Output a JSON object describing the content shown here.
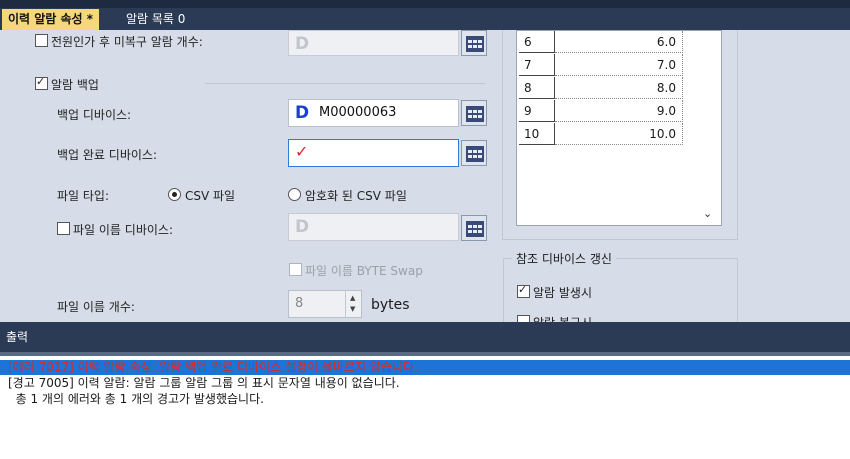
{
  "tabs": [
    {
      "label": "이력 알람 속성 *",
      "active": true
    },
    {
      "label": "알람 목록 0",
      "active": false
    }
  ],
  "form": {
    "power_off_count": {
      "label": "전원인가 후 미복구 알람 개수:",
      "checked": false,
      "value": "D"
    },
    "alarm_backup": {
      "label": "알람 백업",
      "checked": true
    },
    "backup_device": {
      "label": "백업 디바이스:",
      "device_letter": "D",
      "value": "M00000063"
    },
    "backup_done_device": {
      "label": "백업 완료 디바이스:",
      "error_mark": "✓"
    },
    "file_type": {
      "label": "파일 타입:",
      "options": [
        "CSV 파일",
        "암호화 된 CSV 파일"
      ],
      "selected": "CSV 파일"
    },
    "file_name_device": {
      "label": "파일 이름 디바이스:",
      "checked": false,
      "value": "D"
    },
    "file_name_byte_swap": {
      "label": "파일 이름 BYTE Swap",
      "checked": false
    },
    "file_name_count": {
      "label": "파일 이름 개수:",
      "value": "8",
      "unit": "bytes"
    }
  },
  "table": {
    "rows": [
      {
        "index": "6",
        "value": "6.0"
      },
      {
        "index": "7",
        "value": "7.0"
      },
      {
        "index": "8",
        "value": "8.0"
      },
      {
        "index": "9",
        "value": "9.0"
      },
      {
        "index": "10",
        "value": "10.0"
      }
    ]
  },
  "ref_update": {
    "title": "참조 디바이스 갱신",
    "items": [
      {
        "label": "알람 발생시",
        "checked": true
      },
      {
        "label": "알람 복구시",
        "checked": false
      }
    ]
  },
  "output": {
    "title": "출력",
    "lines": [
      {
        "text": "[에러 7017] 이력 알람 속성: 알람 백업 완료 디바이스 설정이 올바르지 않습니다.",
        "type": "error"
      },
      {
        "text": "[경고 7005] 이력 알람: 알람 그룹 알람 그룹 의 표시 문자열 내용이 없습니다.",
        "type": "warning"
      },
      {
        "text": "  총 1 개의 에러와 총 1 개의 경고가 발생했습니다.",
        "type": "info"
      }
    ]
  },
  "colors": {
    "error_text": "#d42a2a",
    "selection": "#1e74d6",
    "header": "#2b3a55",
    "active_tab": "#f6d77c"
  }
}
